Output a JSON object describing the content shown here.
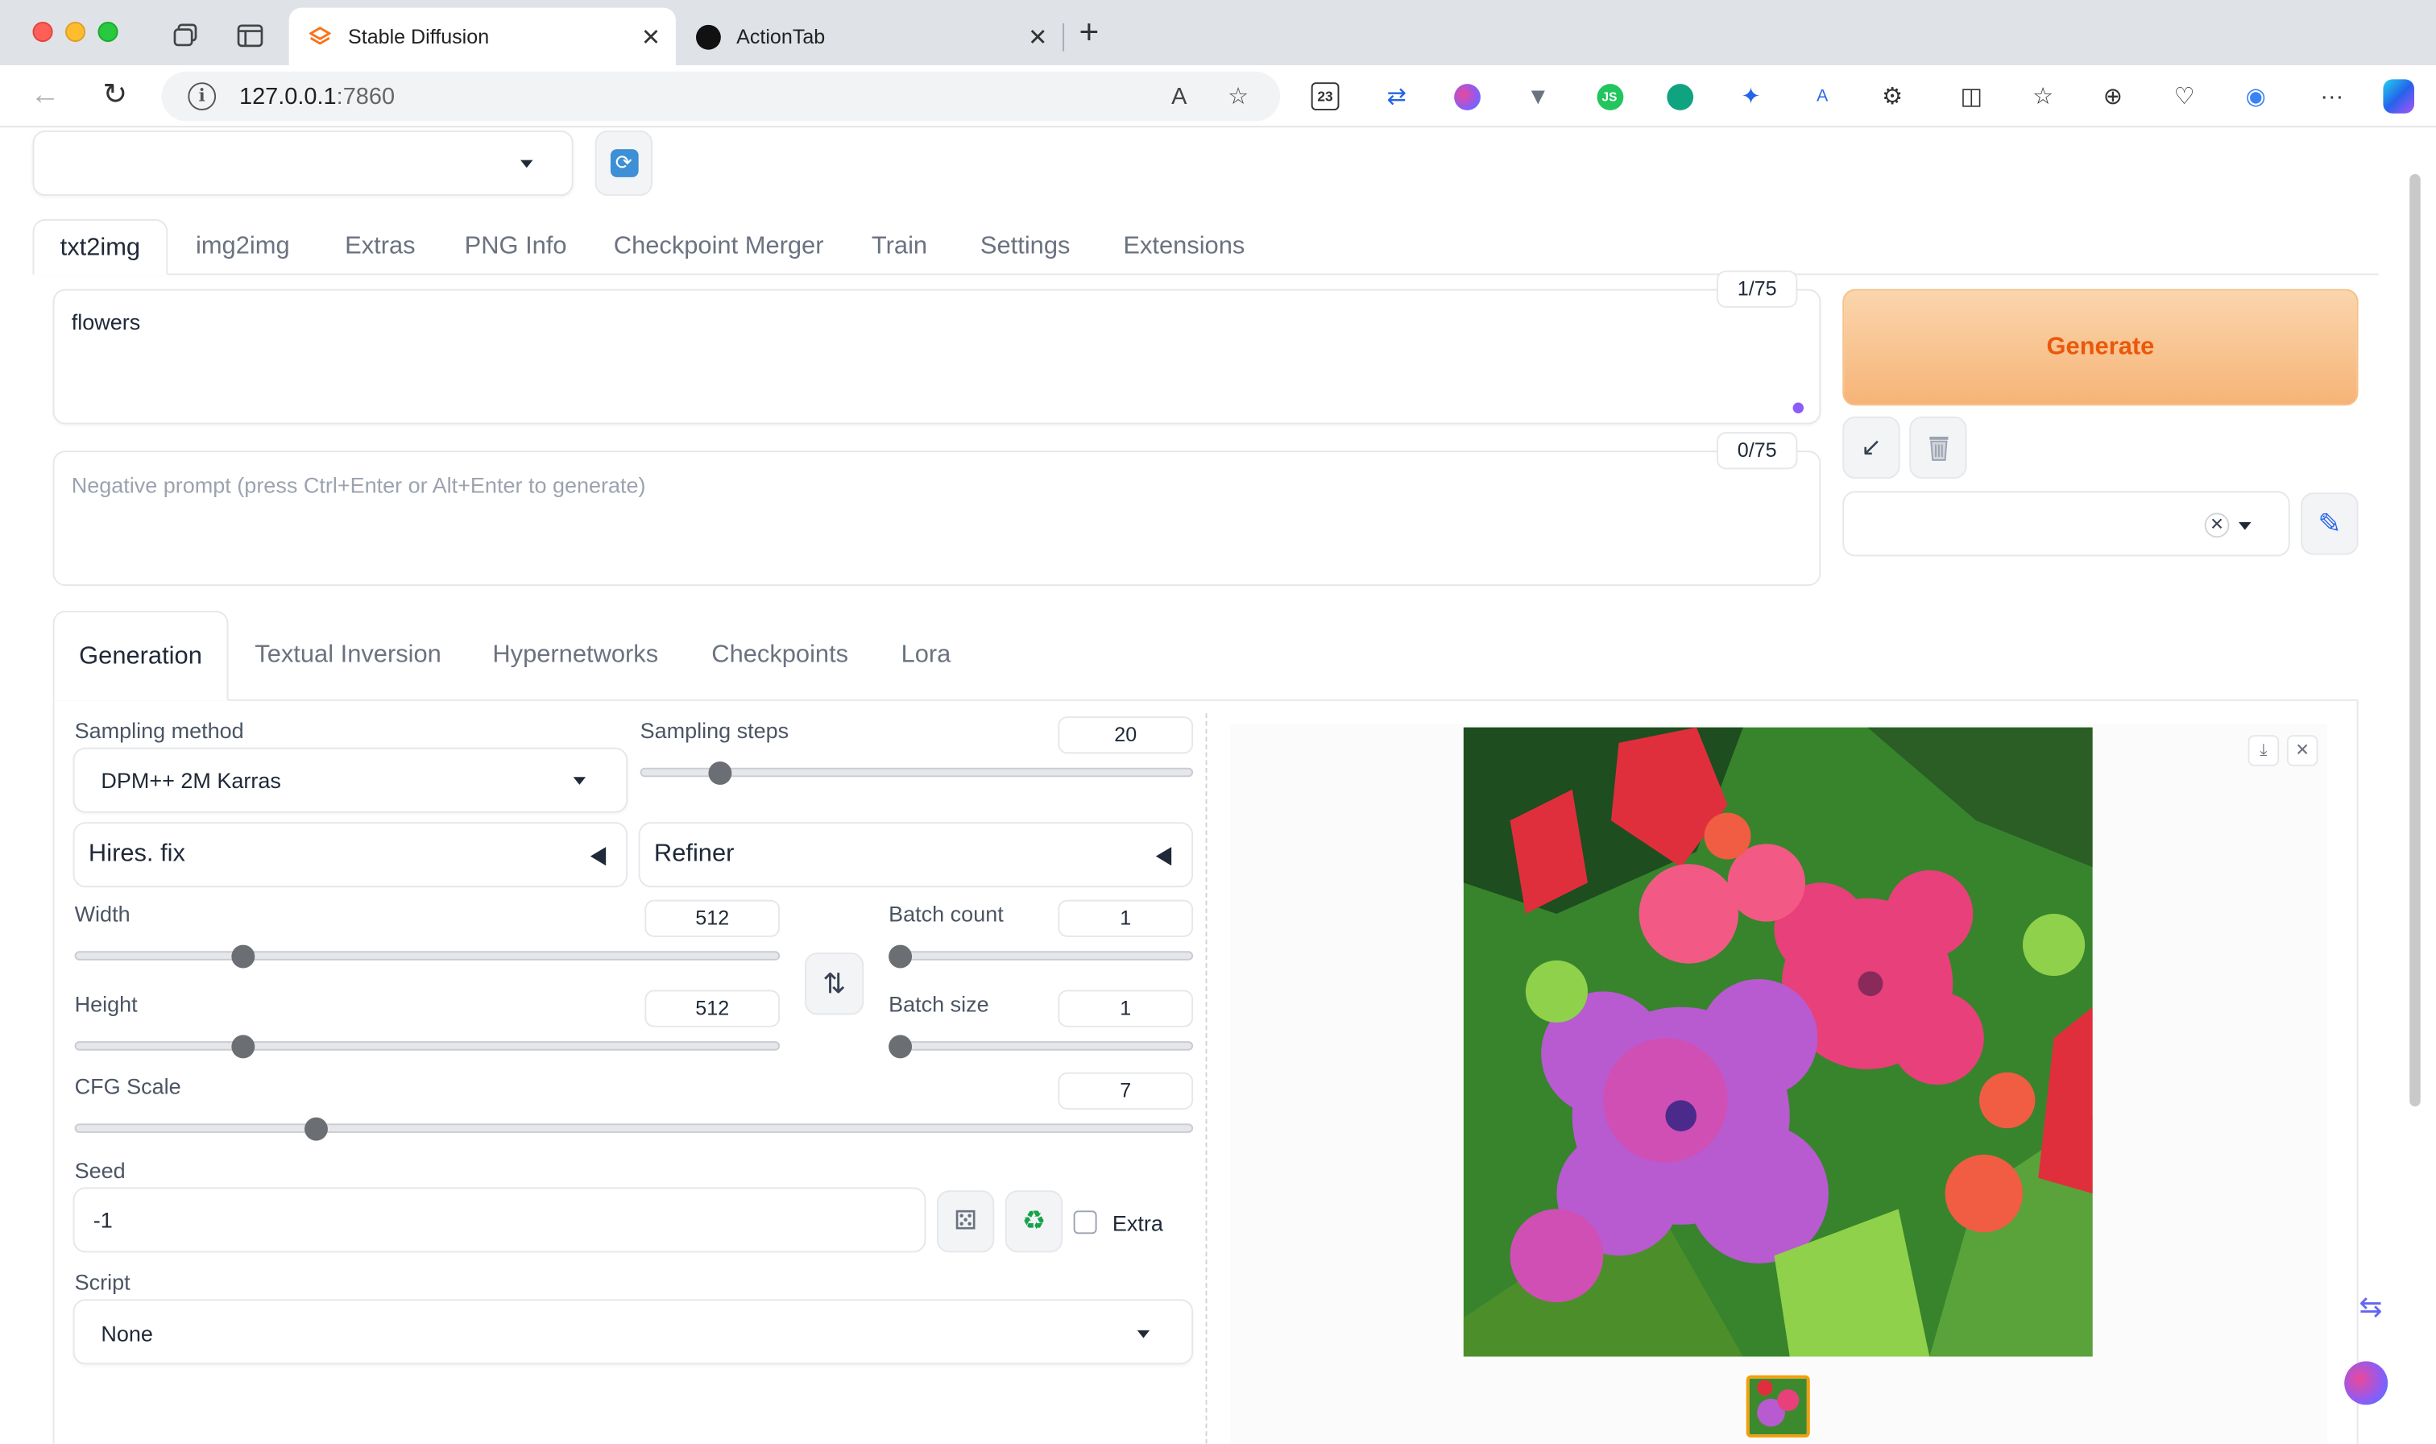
{
  "browser": {
    "tabs": [
      {
        "title": "Stable Diffusion",
        "active": true
      },
      {
        "title": "ActionTab",
        "active": false
      }
    ],
    "url_host": "127.0.0.1",
    "url_port": ":7860"
  },
  "app": {
    "checkpoint_value": "",
    "main_tabs": [
      "txt2img",
      "img2img",
      "Extras",
      "PNG Info",
      "Checkpoint Merger",
      "Train",
      "Settings",
      "Extensions"
    ],
    "prompt": {
      "value": "flowers",
      "token_count": "1/75"
    },
    "negative_prompt": {
      "placeholder": "Negative prompt (press Ctrl+Enter or Alt+Enter to generate)",
      "token_count": "0/75"
    },
    "generate_label": "Generate",
    "sub_tabs": [
      "Generation",
      "Textual Inversion",
      "Hypernetworks",
      "Checkpoints",
      "Lora"
    ],
    "generation": {
      "sampling_method_label": "Sampling method",
      "sampling_method_value": "DPM++ 2M Karras",
      "sampling_steps_label": "Sampling steps",
      "sampling_steps_value": "20",
      "sampling_steps_fraction": 0.13,
      "hires_fix_label": "Hires. fix",
      "refiner_label": "Refiner",
      "width_label": "Width",
      "width_value": "512",
      "width_fraction": 0.23,
      "height_label": "Height",
      "height_value": "512",
      "height_fraction": 0.23,
      "batch_count_label": "Batch count",
      "batch_count_value": "1",
      "batch_count_fraction": 0.0,
      "batch_size_label": "Batch size",
      "batch_size_value": "1",
      "batch_size_fraction": 0.0,
      "cfg_scale_label": "CFG Scale",
      "cfg_scale_value": "7",
      "cfg_scale_fraction": 0.21,
      "seed_label": "Seed",
      "seed_value": "-1",
      "extra_label": "Extra",
      "script_label": "Script",
      "script_value": "None"
    }
  },
  "colors": {
    "generate_text": "#ea580c",
    "generate_bg": "#f6b477",
    "accent_purple": "#8b5cf6",
    "selected_thumb_border": "#f59e0b"
  },
  "icons": {
    "refresh": "refresh-icon",
    "read_paste": "arrow-down-left-icon",
    "trash": "trash-icon",
    "edit": "pencil-icon",
    "swap": "swap-vertical-icon",
    "dice": "dice-icon",
    "recycle": "recycle-icon",
    "download": "download-icon",
    "close": "close-icon"
  }
}
